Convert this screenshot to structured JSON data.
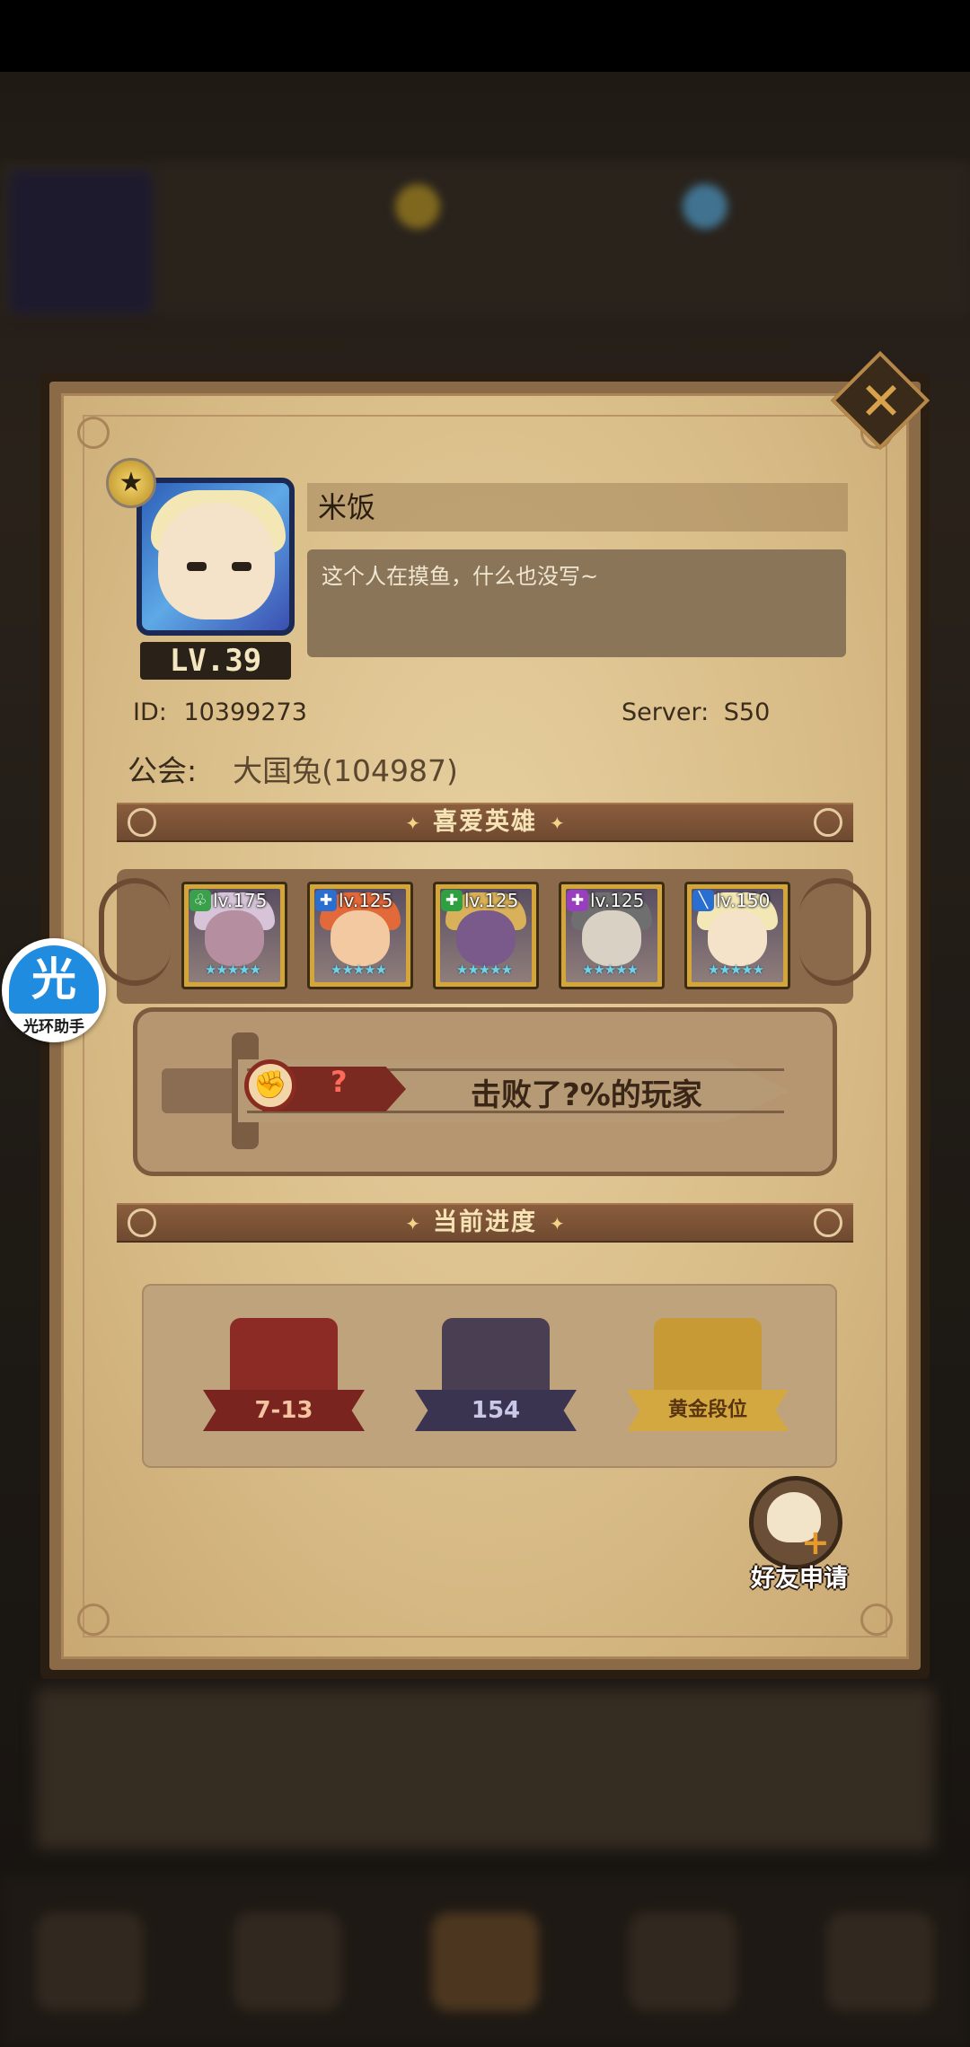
{
  "profile": {
    "name": "米饭",
    "bio": "这个人在摸鱼，什么也没写~",
    "level": "LV.39",
    "id_label": "ID:",
    "id_value": "10399273",
    "server_label": "Server:",
    "server_value": "S50",
    "guild_label": "公会:",
    "guild_value": "大国兔(104987)"
  },
  "sections": {
    "favorite_heroes": "喜爱英雄",
    "current_progress": "当前进度"
  },
  "heroes": [
    {
      "level": "lv.175",
      "class_color": "#3aa04a",
      "class_icon": "leaf-icon",
      "class_glyph": "♧",
      "stars": "★★★★★",
      "hair": "#d7c4d8",
      "face": "#b58ea0"
    },
    {
      "level": "lv.125",
      "class_color": "#2a6fd0",
      "class_icon": "cross-icon",
      "class_glyph": "✚",
      "stars": "★★★★★",
      "hair": "#e26a3a",
      "face": "#f2c9a0"
    },
    {
      "level": "lv.125",
      "class_color": "#2fa040",
      "class_icon": "cross-icon",
      "class_glyph": "✚",
      "stars": "★★★★★",
      "hair": "#d9b15a",
      "face": "#7a5a8a"
    },
    {
      "level": "lv.125",
      "class_color": "#9a3ec0",
      "class_icon": "cross-icon",
      "class_glyph": "✚",
      "stars": "★★★★★",
      "hair": "#6f6f6f",
      "face": "#d9d2c4"
    },
    {
      "level": "lv.150",
      "class_color": "#2a6fd0",
      "class_icon": "sword-icon",
      "class_glyph": "╲",
      "stars": "★★★★★",
      "hair": "#f3e8b5",
      "face": "#f4e3c8"
    }
  ],
  "defeat": {
    "value": "?",
    "text": "击败了?%的玩家"
  },
  "progress": [
    {
      "label": "7-13",
      "kind": "stage-book-icon",
      "emblem_color": "#8c2a26",
      "ribbon_color": "#7a2420",
      "text_color": "#f4c4a0"
    },
    {
      "label": "154",
      "kind": "tower-sword-icon",
      "emblem_color": "#4a3f52",
      "ribbon_color": "#3b3450",
      "text_color": "#c9c8e6"
    },
    {
      "label": "黄金段位",
      "kind": "gold-rank-icon",
      "emblem_color": "#c79a35",
      "ribbon_color": "#d4a840",
      "text_color": "#5a3410"
    }
  ],
  "friend_request": "好友申请",
  "assistant": {
    "glyph": "光",
    "caption": "光环助手"
  }
}
